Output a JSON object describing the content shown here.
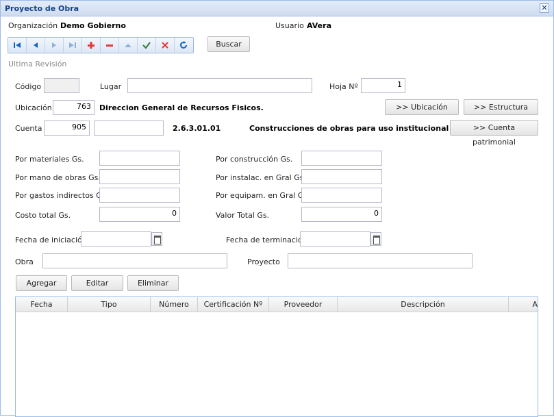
{
  "window": {
    "title": "Proyecto de Obra"
  },
  "header": {
    "org_label": "Organización",
    "org_value": "Demo Gobierno",
    "user_label": "Usuario",
    "user_value": "AVera"
  },
  "toolbar": {
    "search_label": "Buscar"
  },
  "revision_label": "Ultima Revisión",
  "form": {
    "codigo_label": "Código",
    "codigo_value": "",
    "lugar_label": "Lugar",
    "lugar_value": "",
    "hoja_label": "Hoja Nº",
    "hoja_value": "1",
    "ubicacion_label": "Ubicación",
    "ubicacion_value": "763",
    "ubicacion_desc": "Direccion General de Recursos Fisicos.",
    "ubicacion_button": ">> Ubicación",
    "estructura_button": ">> Estructura",
    "cuenta_label": "Cuenta",
    "cuenta_value": "905",
    "cuenta_value2": "",
    "cuenta_code": "2.6.3.01.01",
    "cuenta_desc": "Construcciones de obras para uso institucional",
    "cuenta_button": ">> Cuenta patrimonial",
    "materiales_label": "Por materiales Gs.",
    "materiales_value": "",
    "mano_obra_label": "Por mano de obras Gs.",
    "mano_obra_value": "",
    "gastos_label": "Por gastos indirectos Gs.",
    "gastos_value": "",
    "costo_label": "Costo total Gs.",
    "costo_value": "0",
    "construccion_label": "Por construcción Gs.",
    "construccion_value": "",
    "instalac_label": "Por instalac. en Gral Gs.",
    "instalac_value": "",
    "equipam_label": "Por equipam. en Gral Gs.",
    "equipam_value": "",
    "valor_label": "Valor Total Gs.",
    "valor_value": "0",
    "fecha_ini_label": "Fecha de iniciación",
    "fecha_ini_value": "",
    "fecha_fin_label": "Fecha de terminación",
    "fecha_fin_value": "",
    "obra_label": "Obra",
    "obra_value": "",
    "proyecto_label": "Proyecto",
    "proyecto_value": ""
  },
  "actions": {
    "add": "Agregar",
    "edit": "Editar",
    "delete": "Eliminar"
  },
  "grid": {
    "columns": [
      "Fecha",
      "Tipo",
      "Número",
      "Certificación Nº",
      "Proveedor",
      "Descripción",
      "A"
    ]
  },
  "colors": {
    "title": "#15428b",
    "border": "#99bbe8",
    "icon_blue": "#1565c0",
    "icon_red": "#e53935",
    "icon_green": "#2e7d32"
  }
}
